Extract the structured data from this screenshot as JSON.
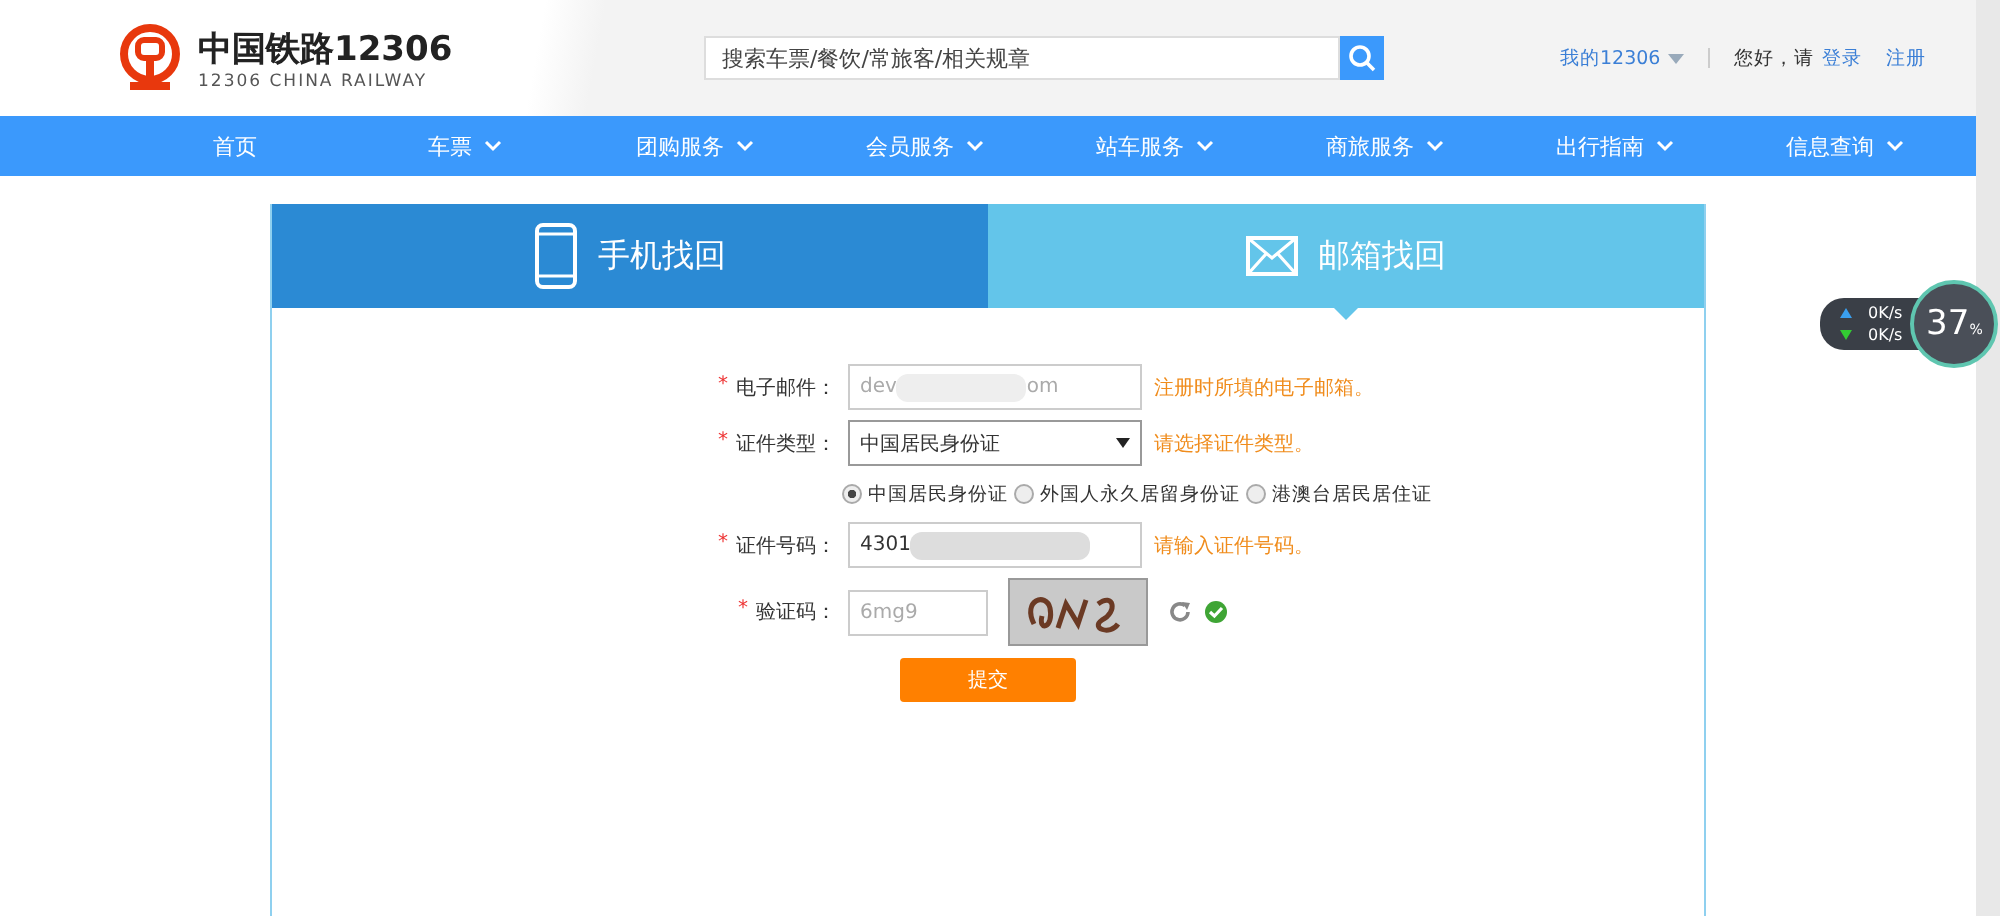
{
  "logo": {
    "title": "中国铁路12306",
    "subtitle": "12306 CHINA RAILWAY"
  },
  "search": {
    "placeholder": "搜索车票/餐饮/常旅客/相关规章"
  },
  "account": {
    "my": "我的12306",
    "greeting": "您好，请",
    "login": "登录",
    "register": "注册"
  },
  "nav": [
    {
      "label": "首页",
      "dropdown": false
    },
    {
      "label": "车票",
      "dropdown": true
    },
    {
      "label": "团购服务",
      "dropdown": true
    },
    {
      "label": "会员服务",
      "dropdown": true
    },
    {
      "label": "站车服务",
      "dropdown": true
    },
    {
      "label": "商旅服务",
      "dropdown": true
    },
    {
      "label": "出行指南",
      "dropdown": true
    },
    {
      "label": "信息查询",
      "dropdown": true
    }
  ],
  "tabs": [
    {
      "label": "手机找回",
      "kind": "phone",
      "selected": false
    },
    {
      "label": "邮箱找回",
      "kind": "mail",
      "selected": true
    }
  ],
  "form": {
    "email": {
      "required_mark": "*",
      "label": "电子邮件：",
      "value_start": "dev",
      "value_end": "om",
      "hint": "注册时所填的电子邮箱。"
    },
    "id_type": {
      "required_mark": "*",
      "label": "证件类型：",
      "value": "中国居民身份证",
      "hint": "请选择证件类型。"
    },
    "id_radios": [
      {
        "label": "中国居民身份证",
        "selected": true
      },
      {
        "label": "外国人永久居留身份证",
        "selected": false
      },
      {
        "label": "港澳台居民居住证",
        "selected": false
      }
    ],
    "id_number": {
      "required_mark": "*",
      "label": "证件号码：",
      "value_start": "4301",
      "hint": "请输入证件号码。"
    },
    "captcha": {
      "required_mark": "*",
      "label": "验证码：",
      "placeholder": "6mg9",
      "verified": true
    },
    "submit": "提交"
  },
  "speed_widget": {
    "upload": "0K/s",
    "download": "0K/s",
    "percent": "37",
    "unit": "%"
  }
}
